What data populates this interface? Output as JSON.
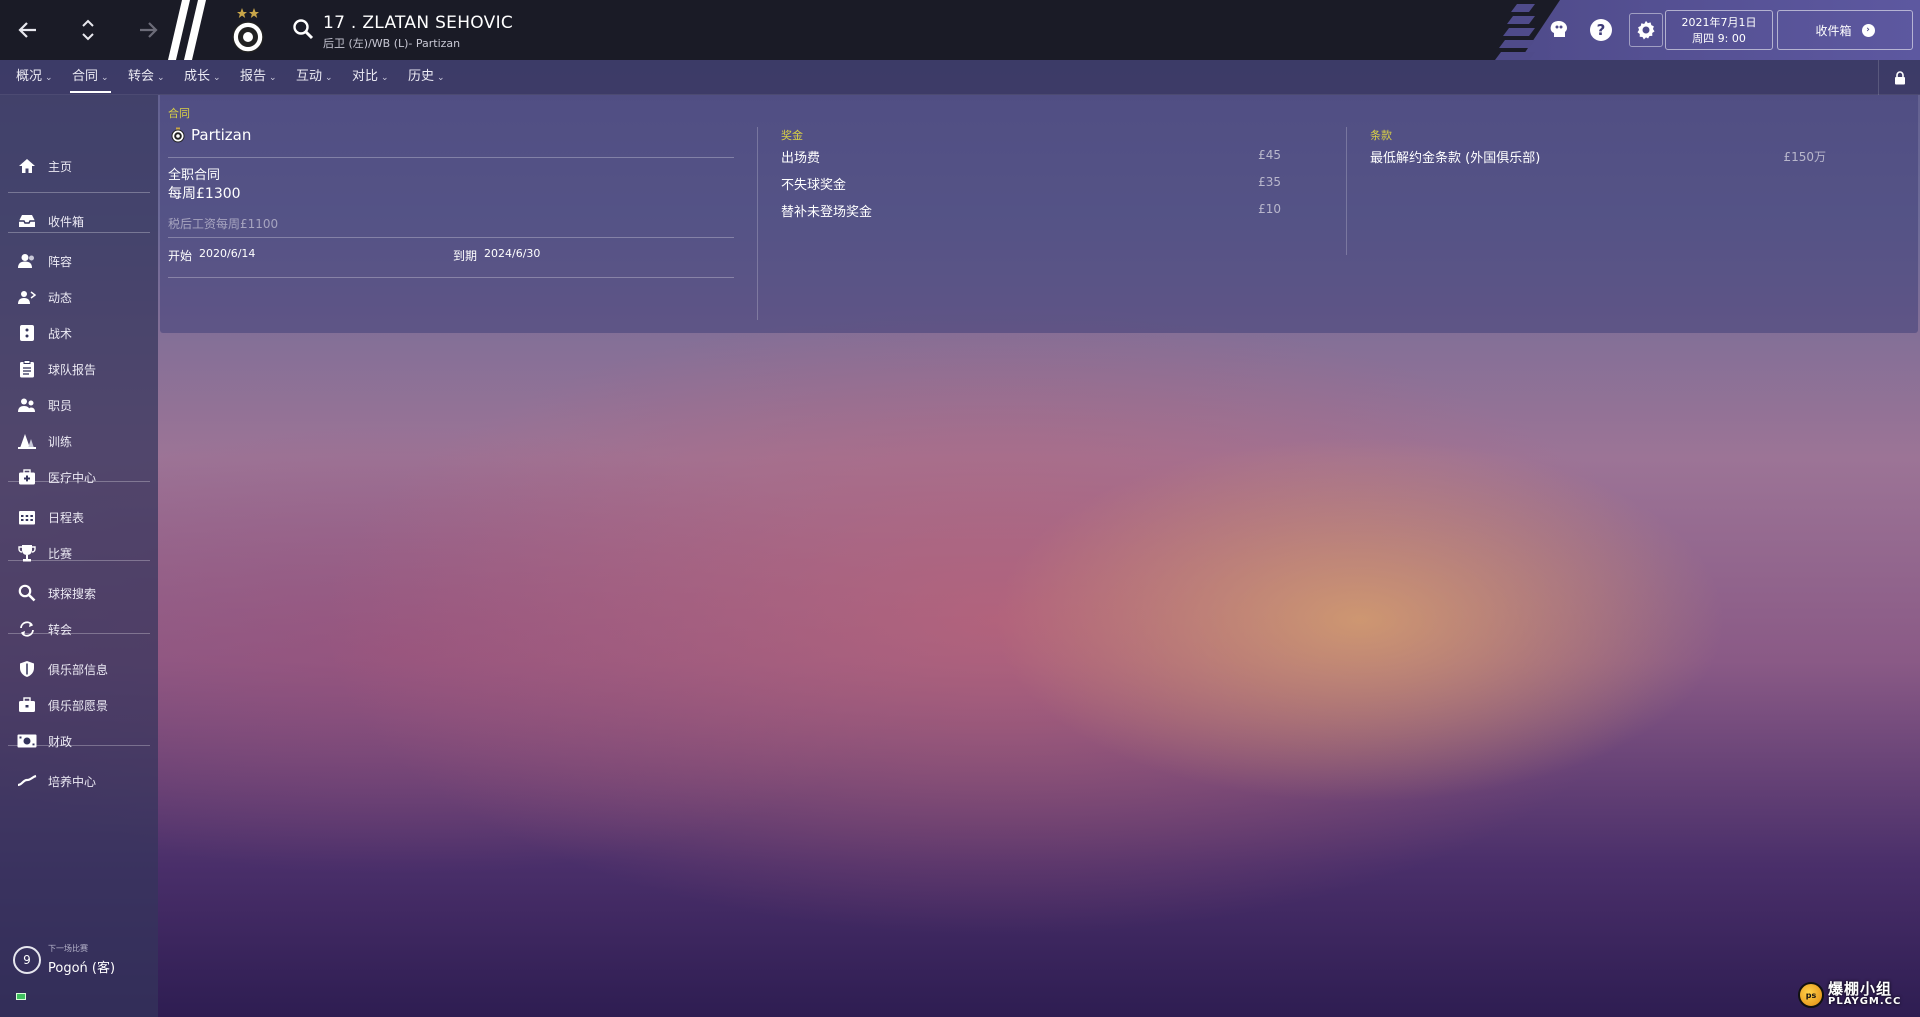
{
  "topbar": {
    "player_name": "17 . ZLATAN SEHOVIC",
    "player_sub": "后卫 (左)/WB (L)- Partizan",
    "date_line1": "2021年7月1日",
    "date_line2": "周四 9: 00",
    "inbox_label": "收件箱"
  },
  "menu": {
    "items": [
      {
        "label": "概况"
      },
      {
        "label": "合同"
      },
      {
        "label": "转会"
      },
      {
        "label": "成长"
      },
      {
        "label": "报告"
      },
      {
        "label": "互动"
      },
      {
        "label": "对比"
      },
      {
        "label": "历史"
      }
    ],
    "active": "合同"
  },
  "sidebar": {
    "items": [
      {
        "label": "主页",
        "icon": "home-icon"
      },
      {
        "label": "收件箱",
        "icon": "inbox-icon"
      },
      {
        "label": "阵容",
        "icon": "squad-icon"
      },
      {
        "label": "动态",
        "icon": "dynamics-icon"
      },
      {
        "label": "战术",
        "icon": "tactics-icon"
      },
      {
        "label": "球队报告",
        "icon": "clipboard-icon"
      },
      {
        "label": "职员",
        "icon": "staff-icon"
      },
      {
        "label": "训练",
        "icon": "training-cone-icon"
      },
      {
        "label": "医疗中心",
        "icon": "medical-kit-icon"
      },
      {
        "label": "日程表",
        "icon": "calendar-icon"
      },
      {
        "label": "比赛",
        "icon": "trophy-icon"
      },
      {
        "label": "球探搜索",
        "icon": "magnifier-icon"
      },
      {
        "label": "转会",
        "icon": "transfer-arrows-icon"
      },
      {
        "label": "俱乐部信息",
        "icon": "shield-icon"
      },
      {
        "label": "俱乐部愿景",
        "icon": "briefcase-icon"
      },
      {
        "label": "财政",
        "icon": "money-icon"
      },
      {
        "label": "培养中心",
        "icon": "trend-icon"
      }
    ],
    "next_match": {
      "label": "下一场比赛",
      "days": "9",
      "opponent": "Pogoń (客)"
    }
  },
  "contract": {
    "section_title": "合同",
    "club": "Partizan",
    "contract_type": "全职合同",
    "weekly_wage": "每周£1300",
    "after_tax": "税后工资每周£1100",
    "start_label": "开始",
    "start_date": "2020/6/14",
    "end_label": "到期",
    "end_date": "2024/6/30"
  },
  "bonuses": {
    "section_title": "奖金",
    "rows": [
      {
        "label": "出场费",
        "value": "£45"
      },
      {
        "label": "不失球奖金",
        "value": "£35"
      },
      {
        "label": "替补未登场奖金",
        "value": "£10"
      }
    ]
  },
  "clauses": {
    "section_title": "条款",
    "rows": [
      {
        "label": "最低解约金条款 (外国俱乐部)",
        "value": "£150万"
      }
    ]
  },
  "watermark": {
    "line1": "爆棚小组",
    "line2": "PLAYGM.CC",
    "logo_text": "ps"
  },
  "colors": {
    "topbar_bg": "#1a1b26",
    "accent": "#5d58a0",
    "section_title": "#d9d046"
  }
}
